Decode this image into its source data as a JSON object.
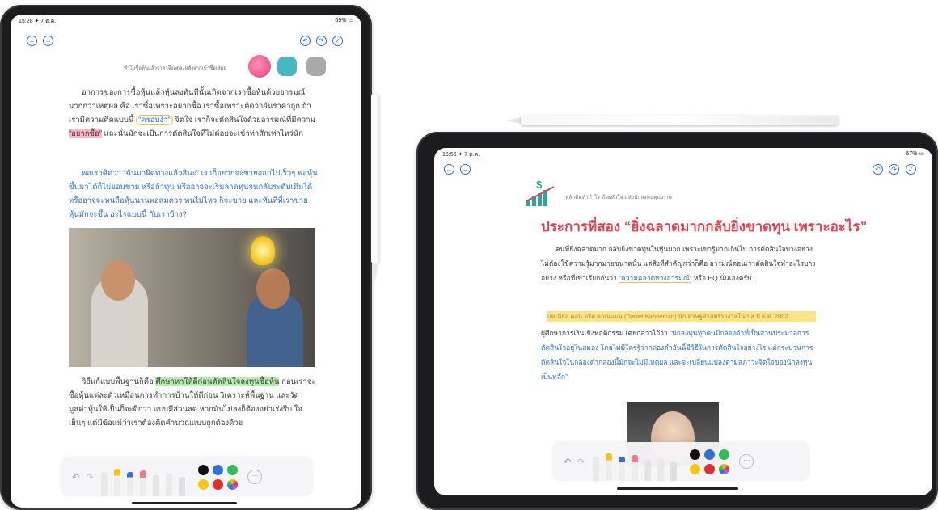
{
  "left_ipad": {
    "status_time": "15:28 ✦ 7 ต.ค.",
    "status_battery": "69% ▭",
    "nav": {
      "back": "←",
      "forward": "→",
      "undo": "↶",
      "redo": "↷",
      "done": "✓"
    },
    "subtitle": "ทำไมชื้อหุ้นแล้วราคาจึงลดลงหลังจากเข้าซื้อเสมอ",
    "paragraph1_a": "อาการของการซื้อหุ้นแล้วหุ้นลงทันทีนั้นเกิดจากเราซื้อหุ้นด้วยอารมณ์มากกว่าเหตุผล คือ เราซื้อเพราะอยากซื้อ เราซื้อเพราะคิดว่าผันราคาถูก ถ้าเรามีความคิดแบบนี้",
    "paragraph1_hl1": "“ครอบงำ”",
    "paragraph1_b": " จิตใจ เราก็จะตัดสินใจด้วยอารมณ์ที่มีความ",
    "paragraph1_hl2": "“อยากซื้อ”",
    "paragraph1_c": " และนั่นมักจะเป็นการตัดสินใจที่ไม่ค่อยจะเข้าท่าสักเท่าไหร่นัก",
    "paragraph2": "พอเราคิดว่า “ฉันมาผิดทางแล้วสินะ” เราก็อยากจะขายออกไปเร็วๆ พอหุ้นขึ้นมาได้ก็ไม่ยอมขาย หรือถ้าทุน หรืออาจจะเริ่มลาดทุนจนกลับระดับเดิมได้ หรืออาจจะทนถือหุ้นนานพอสมควร ทนไม่ไหว ก็จะขาย และทันทีที่เราขายหุ้นมักจะขึ้น อะไรแบบนี้ กับเราบ้าง?",
    "paragraph3_a": "วิธีแก้แบบพื้นฐานก็คือ",
    "paragraph3_hl": "ศึกษาหาให้ดีก่อนตัดสินใจลงทุนซื้อหุ้น",
    "paragraph3_b": " ก่อนเราจะซื้อหุ้นแต่ละตัวเหมือนการทำการบ้านให้ดีก่อน วิเคราะห์พื้นฐาน และวัดมูลค่าหุ้นให้เป็นก็จะดีกว่า แบบมีส่วนลด หากมันไม่ลงก็ต้องอย่าเร่งรีบ ใจเย็นๆ แต่มีข้อแม้ว่าเราต้องคิดคำนวณแบบถูกต้องด้วย",
    "toolbar_colors": [
      "#111111",
      "#2f6fd6",
      "#2fbf55",
      "#f5c518",
      "#e23030",
      "#c45ad6"
    ],
    "more_label": "···",
    "undo_icon": "↶",
    "redo_icon": "↷"
  },
  "right_ipad": {
    "status_time": "15:56 ✦ 7 ต.ค.",
    "status_battery": "67% ▭",
    "nav": {
      "back": "←",
      "forward": "→",
      "undo": "↶",
      "redo": "↷",
      "done": "✓"
    },
    "logo_symbol": "$",
    "subtitle": "หลักคิดทำกำไร ด้วยหัวใจ แห่งนักลงทุนคุณภาพ",
    "heading": "ประการที่สอง “ยิ่งฉลาดมากกลับยิ่งขาดทุน เพราะอะไร”",
    "paragraph1": "คนที่ยิ่งฉลาดมาก กลับยิ่งขาดทุนในหุ้นมาก เพราะเขารู้มากเกินไป การตัดสินใจบางอย่างไม่ต้องใช้ความรู้มากมายขนาดนั้น แต่สิ่งที่สำคัญกว่าก็คือ อารมณ์ตอนเราตัดสินใจทำอะไรบางอย่าง หรือที่เขาเรียกกันว่า ",
    "paragraph1_link": "“ความฉลาดทางอารมณ์”",
    "paragraph1_end": " หรือ EQ นั่นเองครับ",
    "hl_line": "แดเนียล คอน ตรีต คาเนแมน (Daniel Kahneman) นักเศรษฐศาสตร์รางวัลโนเบล ปี ค.ศ. 2002",
    "blue_para_a": "ผู้ศึกษาการเงินเชิงพฤติกรรม เคยกล่าวไว้ว่า ",
    "blue_para_b": "“นักลงทุนทุกคนมีกล่องดำที่เป็นส่วนประมวลการตัดสินใจอยู่ในสมอง โดยไม่มีใครรู้ว่ากล่องดำอันนี้มีวิธีในการตัดสินใจอย่างไร แต่กระบวนการตัดสินใจในกล่องดำกล่องนี้มักจะไม่มีเหตุผล และจะเปลี่ยนแปลงตามสภาวะจิตใจของนักลงทุนเป็นหลัก”",
    "toolbar_colors": [
      "#111111",
      "#2f6fd6",
      "#2fbf55",
      "#f5c518",
      "#e23030",
      "#c45ad6"
    ],
    "more_label": "···",
    "undo_icon": "↶",
    "redo_icon": "↷"
  }
}
